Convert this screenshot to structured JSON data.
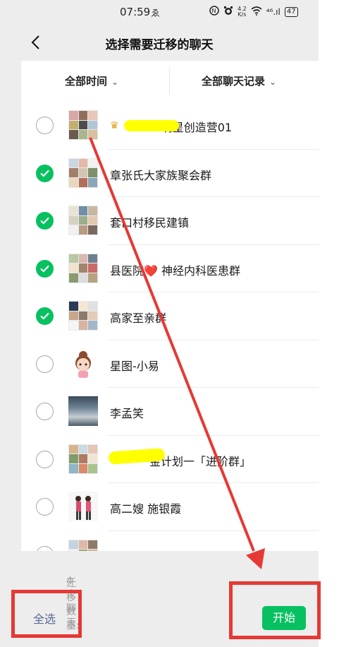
{
  "status_bar": {
    "time": "07:59",
    "extra": "ゑ",
    "net_speed_top": "4.2",
    "net_speed_bottom": "K/s",
    "signal": "⁴⁶.ıl",
    "battery": "47"
  },
  "nav": {
    "title": "选择需要迁移的聊天"
  },
  "filters": {
    "time_label": "全部时间",
    "records_label": "全部聊天记录",
    "arrow": "⌄"
  },
  "chats": [
    {
      "name": "STAR明星创造营01",
      "checked": false
    },
    {
      "name": "章张氏大家族聚会群",
      "checked": true
    },
    {
      "name": "套口村移民建镇",
      "checked": true
    },
    {
      "name": "县医院❤️ 神经内科医患群",
      "checked": true
    },
    {
      "name": "高家至亲群",
      "checked": true
    },
    {
      "name": "星图-小易",
      "checked": false
    },
    {
      "name": "李孟笑",
      "checked": false
    },
    {
      "name": "金计划一「进阶群」",
      "checked": false
    },
    {
      "name": "高二嫂 施银霞",
      "checked": false
    }
  ],
  "footer": {
    "count_label": "迁移数量:",
    "count_value": "4 个聊天",
    "select_all": "全选",
    "start": "开始"
  },
  "colors": {
    "accent_green": "#07c160",
    "link_blue": "#576b95",
    "annotation_red": "#e53935",
    "redaction_yellow": "#ffff00"
  }
}
